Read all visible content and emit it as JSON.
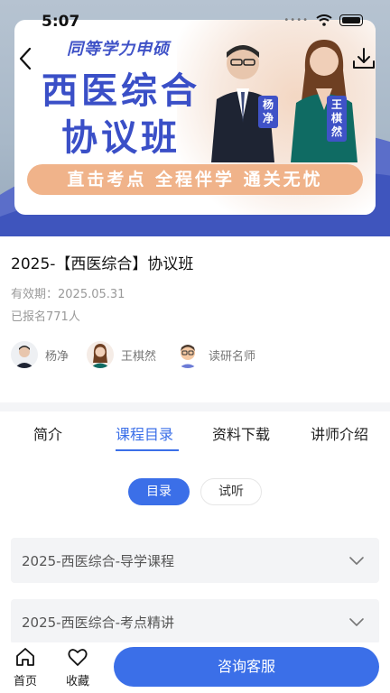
{
  "status_bar": {
    "time": "5:07"
  },
  "banner": {
    "subtitle": "同等学力申硕",
    "title_line1": "西医综合",
    "title_line2": "协议班",
    "tagline": "直击考点 全程伴学 通关无忧",
    "teacher_tag1": "杨净",
    "teacher_tag2": "王棋然"
  },
  "course": {
    "title": "2025-【西医综合】协议班",
    "validity": "有效期：2025.05.31",
    "enrolled": "已报名771人"
  },
  "teachers": [
    {
      "name": "杨净"
    },
    {
      "name": "王棋然"
    },
    {
      "name": "读研名师"
    }
  ],
  "tabs": [
    {
      "label": "简介"
    },
    {
      "label": "课程目录"
    },
    {
      "label": "资料下载"
    },
    {
      "label": "讲师介绍"
    }
  ],
  "active_tab": "课程目录",
  "segments": {
    "catalog": "目录",
    "trial": "试听"
  },
  "sections": [
    {
      "label": "2025-西医综合-导学课程"
    },
    {
      "label": "2025-西医综合-考点精讲"
    }
  ],
  "bottom_bar": {
    "home_label": "首页",
    "favorite_label": "收藏",
    "consult_label": "咨询客服"
  },
  "colors": {
    "accent": "#3b6fe8",
    "banner_blue": "#3a4fc7",
    "band_orange": "#f0b38a"
  }
}
